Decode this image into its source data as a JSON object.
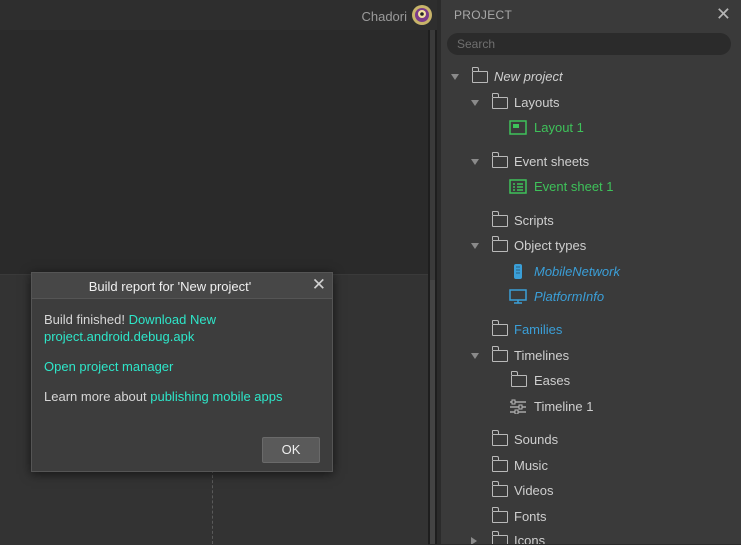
{
  "header": {
    "username": "Chadori"
  },
  "panel": {
    "title": "PROJECT",
    "search_placeholder": "Search",
    "tree": {
      "root": "New project",
      "layouts": "Layouts",
      "layout1": "Layout 1",
      "event_sheets": "Event sheets",
      "event_sheet1": "Event sheet 1",
      "scripts": "Scripts",
      "object_types": "Object types",
      "mobile_network": "MobileNetwork",
      "platform_info": "PlatformInfo",
      "families": "Families",
      "timelines": "Timelines",
      "eases": "Eases",
      "timeline1": "Timeline 1",
      "sounds": "Sounds",
      "music": "Music",
      "videos": "Videos",
      "fonts": "Fonts",
      "icons": "Icons"
    }
  },
  "dialog": {
    "title": "Build report for 'New project'",
    "build_finished": "Build finished! ",
    "download_link": "Download New project.android.debug.apk",
    "open_manager": "Open project manager",
    "learn_more": "Learn more about ",
    "publishing_link": "publishing mobile apps",
    "ok": "OK"
  },
  "colors": {
    "link": "#2ee6c9",
    "layout_green": "#3ec25a",
    "object_blue": "#3a9fd8"
  }
}
